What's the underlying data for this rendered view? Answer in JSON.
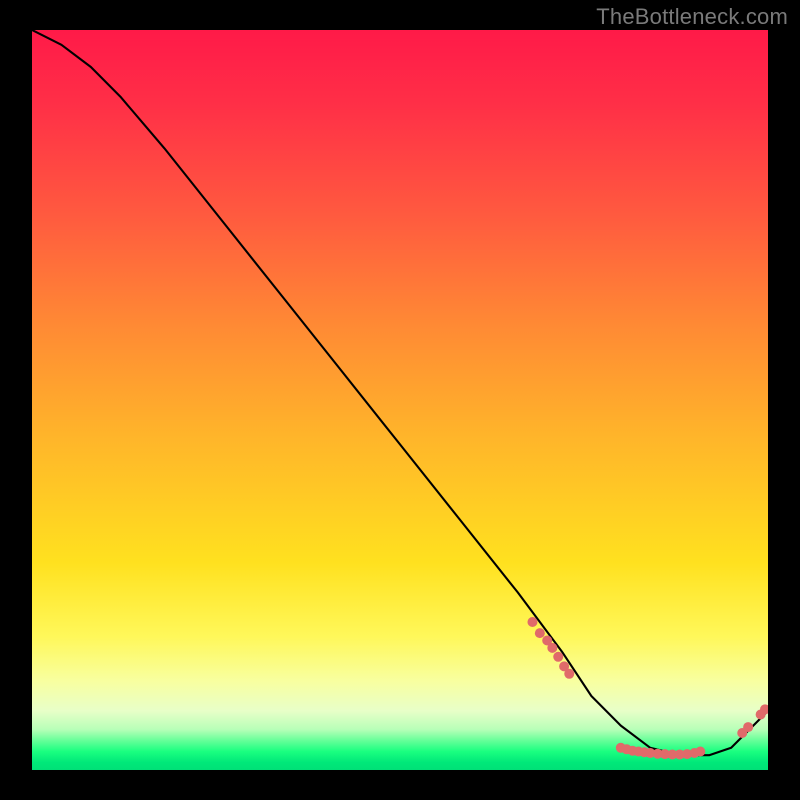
{
  "watermark": "TheBottleneck.com",
  "chart_data": {
    "type": "line",
    "title": "",
    "xlabel": "",
    "ylabel": "",
    "xlim": [
      0,
      100
    ],
    "ylim": [
      0,
      100
    ],
    "grid": false,
    "legend": false,
    "background": "heat-gradient",
    "series": [
      {
        "name": "bottleneck-curve",
        "x": [
          0,
          4,
          8,
          12,
          18,
          26,
          34,
          42,
          50,
          58,
          66,
          72,
          76,
          80,
          84,
          88,
          92,
          95,
          98,
          100
        ],
        "y": [
          100,
          98,
          95,
          91,
          84,
          74,
          64,
          54,
          44,
          34,
          24,
          16,
          10,
          6,
          3,
          2,
          2,
          3,
          6,
          8
        ],
        "color": "#000000"
      }
    ],
    "markers": [
      {
        "name": "cluster-descent",
        "color": "#e06a6a",
        "points": [
          {
            "x": 68,
            "y": 20
          },
          {
            "x": 69,
            "y": 18.5
          },
          {
            "x": 70,
            "y": 17.5
          },
          {
            "x": 70.7,
            "y": 16.5
          },
          {
            "x": 71.5,
            "y": 15.3
          },
          {
            "x": 72.3,
            "y": 14
          },
          {
            "x": 73,
            "y": 13
          }
        ]
      },
      {
        "name": "cluster-valley",
        "color": "#e06a6a",
        "points": [
          {
            "x": 80,
            "y": 3.0
          },
          {
            "x": 80.8,
            "y": 2.8
          },
          {
            "x": 81.6,
            "y": 2.6
          },
          {
            "x": 82.4,
            "y": 2.5
          },
          {
            "x": 83.2,
            "y": 2.4
          },
          {
            "x": 84.0,
            "y": 2.3
          },
          {
            "x": 85.0,
            "y": 2.2
          },
          {
            "x": 86.0,
            "y": 2.15
          },
          {
            "x": 87.0,
            "y": 2.1
          },
          {
            "x": 88.0,
            "y": 2.1
          },
          {
            "x": 89.0,
            "y": 2.15
          },
          {
            "x": 90.0,
            "y": 2.3
          },
          {
            "x": 90.8,
            "y": 2.5
          }
        ]
      },
      {
        "name": "cluster-rise",
        "color": "#e06a6a",
        "points": [
          {
            "x": 96.5,
            "y": 5.0
          },
          {
            "x": 97.3,
            "y": 5.8
          },
          {
            "x": 99.0,
            "y": 7.5
          },
          {
            "x": 99.6,
            "y": 8.2
          }
        ]
      }
    ]
  }
}
